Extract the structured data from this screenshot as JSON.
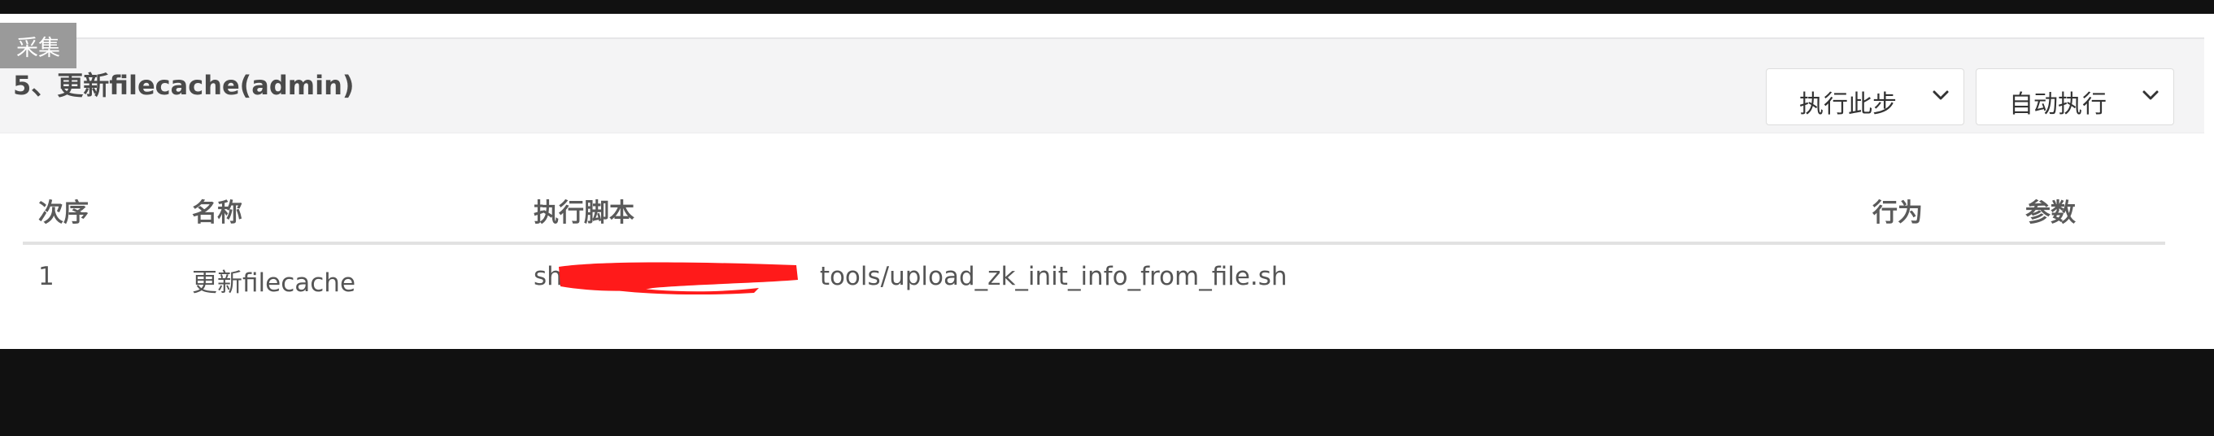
{
  "badge": {
    "label": "采集"
  },
  "step": {
    "title": "5、更新filecache(admin)"
  },
  "controls": {
    "execute_step": {
      "label": "执行此步",
      "icon": "chevron-down-icon"
    },
    "auto_execute": {
      "label": "自动执行",
      "icon": "chevron-down-icon"
    }
  },
  "table": {
    "columns": [
      "次序",
      "名称",
      "执行脚本",
      "行为",
      "参数"
    ],
    "rows": [
      {
        "order": "1",
        "name": "更新filecache",
        "script_prefix": "sh",
        "script_suffix": "tools/upload_zk_init_info_from_file.sh",
        "action": "",
        "params": ""
      }
    ]
  },
  "colors": {
    "badge_bg": "#9a9a9a",
    "header_band": "#f4f4f5",
    "redaction": "#ff1a1a",
    "frame": "#111111"
  }
}
